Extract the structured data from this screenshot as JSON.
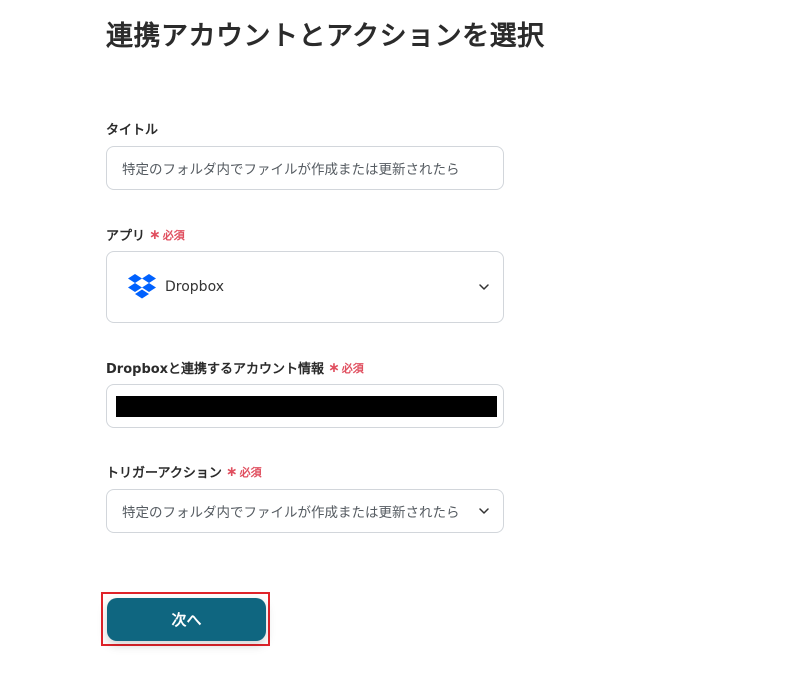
{
  "page": {
    "title": "連携アカウントとアクションを選択"
  },
  "fields": {
    "title": {
      "label": "タイトル",
      "value": "特定のフォルダ内でファイルが作成または更新されたら"
    },
    "app": {
      "label": "アプリ",
      "required": "必須",
      "selected_app": "Dropbox",
      "icon": "dropbox-logo"
    },
    "account": {
      "label": "Dropboxと連携するアカウント情報",
      "required": "必須"
    },
    "trigger": {
      "label": "トリガーアクション",
      "required": "必須",
      "value": "特定のフォルダ内でファイルが作成または更新されたら"
    }
  },
  "actions": {
    "next_label": "次へ"
  },
  "colors": {
    "accent": "#0f6680",
    "required": "#e04f5f",
    "highlight": "#e0232a",
    "dropbox": "#0061fe"
  }
}
